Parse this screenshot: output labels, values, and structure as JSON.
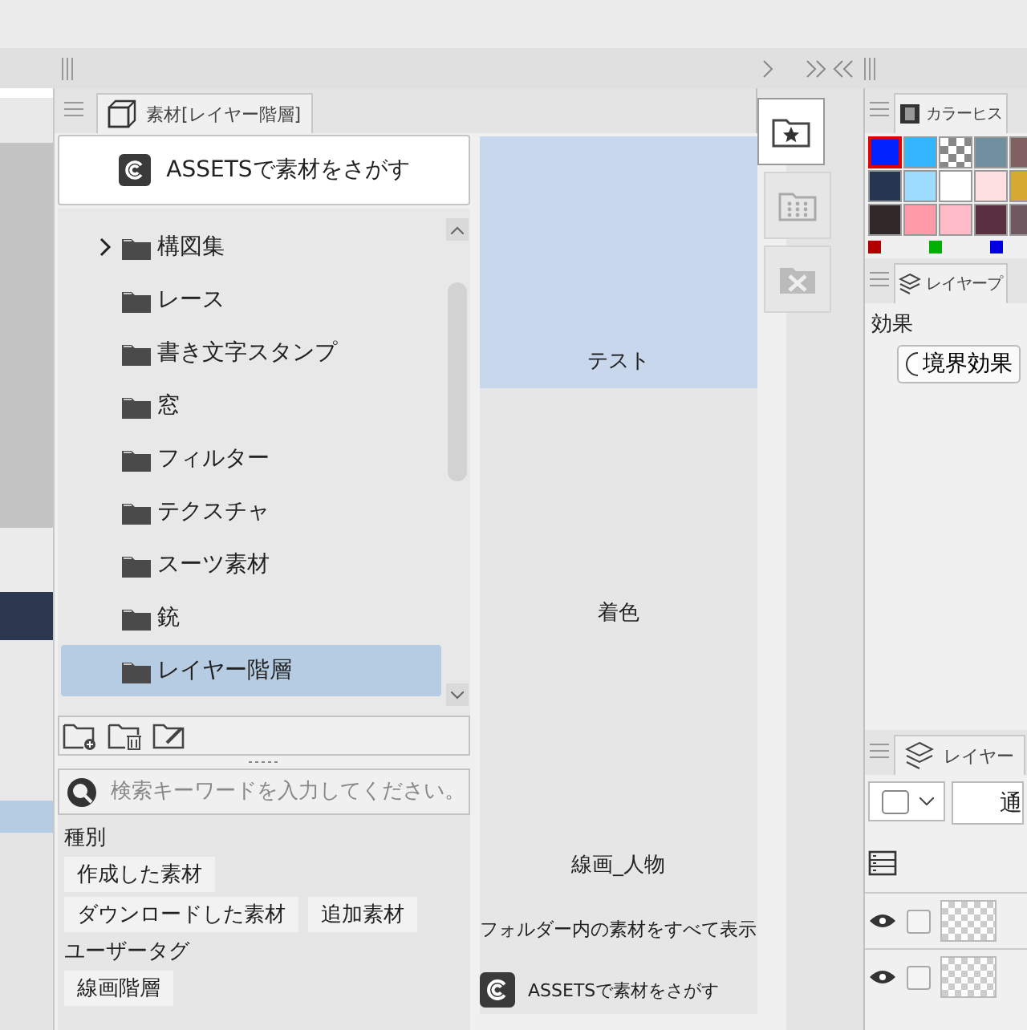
{
  "material_tab": {
    "label": "素材[レイヤー階層]"
  },
  "assets_button": {
    "label": "ASSETSで素材をさがす"
  },
  "tree": {
    "items": [
      {
        "label": "構図集",
        "expandable": true,
        "selected": false
      },
      {
        "label": "レース",
        "expandable": false,
        "selected": false
      },
      {
        "label": "書き文字スタンプ",
        "expandable": false,
        "selected": false
      },
      {
        "label": "窓",
        "expandable": false,
        "selected": false
      },
      {
        "label": "フィルター",
        "expandable": false,
        "selected": false
      },
      {
        "label": "テクスチャ",
        "expandable": false,
        "selected": false
      },
      {
        "label": "スーツ素材",
        "expandable": false,
        "selected": false
      },
      {
        "label": "銃",
        "expandable": false,
        "selected": false
      },
      {
        "label": "レイヤー階層",
        "expandable": false,
        "selected": true
      }
    ]
  },
  "search": {
    "placeholder": "検索キーワードを入力してください。"
  },
  "tag_sections": [
    {
      "title": "種別",
      "tags": [
        [
          "作成した素材"
        ],
        [
          "ダウンロードした素材",
          "追加素材"
        ]
      ]
    },
    {
      "title": "ユーザータグ",
      "tags": [
        [
          "線画階層"
        ]
      ]
    }
  ],
  "materials": [
    {
      "label": "テスト",
      "selected": true
    },
    {
      "label": "着色",
      "selected": false
    },
    {
      "label": "線画_人物",
      "selected": false
    }
  ],
  "show_all": "フォルダー内の素材をすべて表示",
  "assets_link": "ASSETSで素材をさがす",
  "side_tabs": [
    {
      "kind": "favorite",
      "selected": true
    },
    {
      "kind": "grid",
      "selected": false
    },
    {
      "kind": "remove",
      "selected": false
    }
  ],
  "color_history": {
    "tab": "カラーヒス",
    "swatches": [
      {
        "color": "#0022ff",
        "selected": true
      },
      {
        "color": "#33b5ff",
        "selected": false
      },
      {
        "color": "#888888",
        "selected": false,
        "kind": "transparent"
      },
      {
        "color": "#7090a0",
        "selected": false
      },
      {
        "color": "#806060",
        "selected": false
      },
      {
        "color": "#243650",
        "selected": false
      },
      {
        "color": "#9ddcff",
        "selected": false
      },
      {
        "color": "#ffffff",
        "selected": false
      },
      {
        "color": "#ffe0e0",
        "selected": false
      },
      {
        "color": "#d4aa33",
        "selected": false
      },
      {
        "color": "#302828",
        "selected": false
      },
      {
        "color": "#ff9aa8",
        "selected": false
      },
      {
        "color": "#ffbcc8",
        "selected": false
      },
      {
        "color": "#5a3040",
        "selected": false
      },
      {
        "color": "#705860",
        "selected": false
      }
    ],
    "dots": [
      {
        "color": "#b00000"
      },
      {
        "color": "#00b000"
      },
      {
        "color": "#0000e0"
      }
    ]
  },
  "layer_property": {
    "tab": "レイヤープ",
    "group": "効果",
    "option": "境界効果"
  },
  "layers": {
    "tab": "レイヤー",
    "blend": "通",
    "rows": [
      {
        "visible": true,
        "checked": false
      },
      {
        "visible": true,
        "checked": false
      }
    ]
  }
}
